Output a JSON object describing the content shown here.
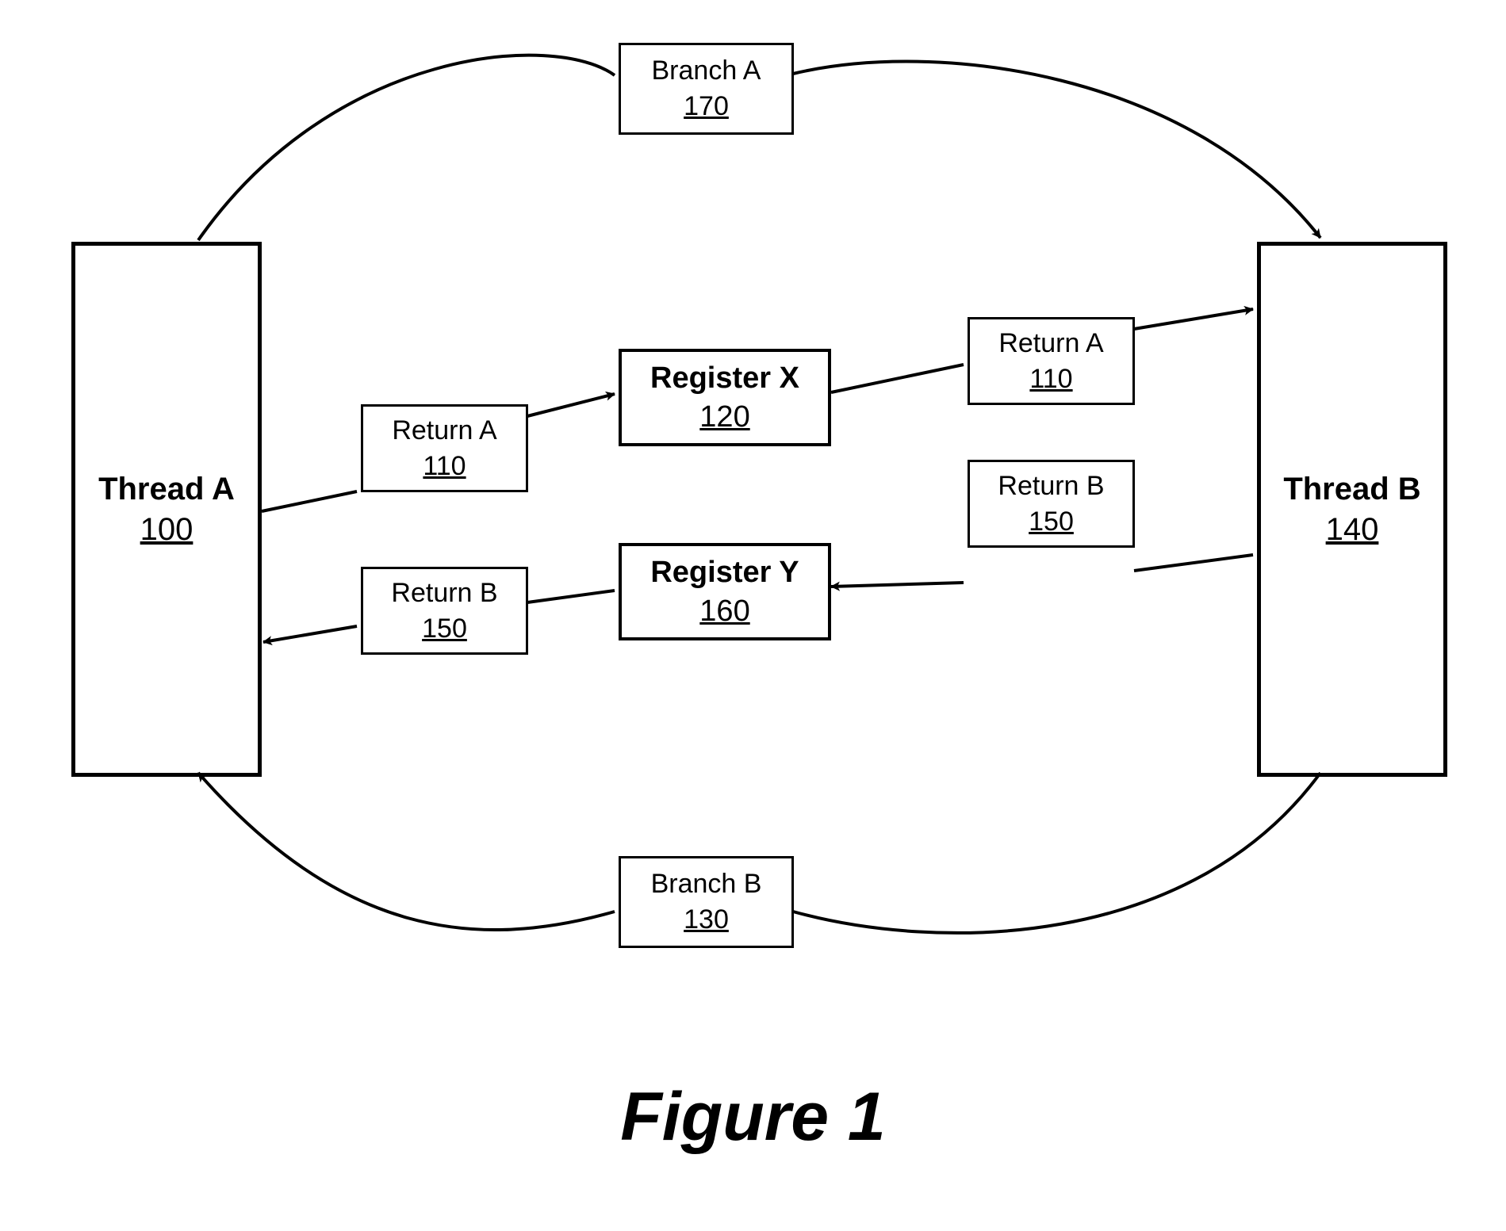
{
  "thread_a": {
    "title": "Thread A",
    "num": "100"
  },
  "thread_b": {
    "title": "Thread B",
    "num": "140"
  },
  "register_x": {
    "title": "Register X",
    "num": "120"
  },
  "register_y": {
    "title": "Register Y",
    "num": "160"
  },
  "branch_a": {
    "title": "Branch A",
    "num": "170"
  },
  "branch_b": {
    "title": "Branch B",
    "num": "130"
  },
  "return_a_left": {
    "title": "Return A",
    "num": "110"
  },
  "return_a_right": {
    "title": "Return A",
    "num": "110"
  },
  "return_b_left": {
    "title": "Return B",
    "num": "150"
  },
  "return_b_right": {
    "title": "Return B",
    "num": "150"
  },
  "figure_label": "Figure 1"
}
